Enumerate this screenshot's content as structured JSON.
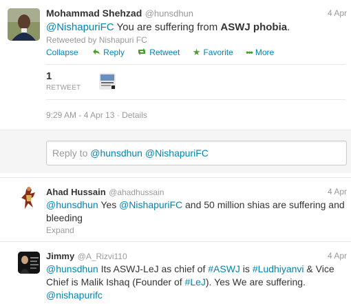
{
  "main_tweet": {
    "name": "Mohammad Shehzad",
    "handle": "@hunsdhun",
    "date": "4 Apr",
    "mention": "@NishapuriFC",
    "text_before_bold": " You are suffering from ",
    "text_bold": "ASWJ phobia",
    "text_after_bold": ".",
    "retweeted_by": "Retweeted by Nishapuri FC",
    "actions": {
      "collapse": "Collapse",
      "reply": "Reply",
      "retweet": "Retweet",
      "favorite": "Favorite",
      "more": "More"
    },
    "retweet_count": "1",
    "retweet_label": "RETWEET",
    "timestamp": "9:29 AM - 4 Apr 13",
    "details_sep": " · ",
    "details": "Details"
  },
  "reply_box": {
    "prefix": "Reply to ",
    "mention1": "@hunsdhun",
    "mention2": "@NishapuriFC"
  },
  "replies": [
    {
      "name": "Ahad Hussain",
      "handle": "@ahadhussain",
      "date": "4 Apr",
      "m1": "@hunsdhun",
      "t1": " Yes ",
      "m2": "@NishapuriFC",
      "t2": " and 50 million shias are suffering and bleeding",
      "expand": "Expand"
    },
    {
      "name": "Jimmy",
      "handle": "@A_Rizvi110",
      "date": "4 Apr",
      "m1": "@hunsdhun",
      "t1": " Its ASWJ-LeJ as chief of ",
      "h1": "#ASWJ",
      "t2": " is ",
      "h2": "#Ludhiyanvi",
      "t3": " & Vice Chief is Malik Ishaq (Founder of ",
      "h3": "#LeJ",
      "t4": "). Yes We are suffering. ",
      "m2": "@nishapurifc"
    }
  ],
  "colors": {
    "link": "#0084b4",
    "muted": "#999999",
    "favorite_green": "#4a9d2e"
  }
}
